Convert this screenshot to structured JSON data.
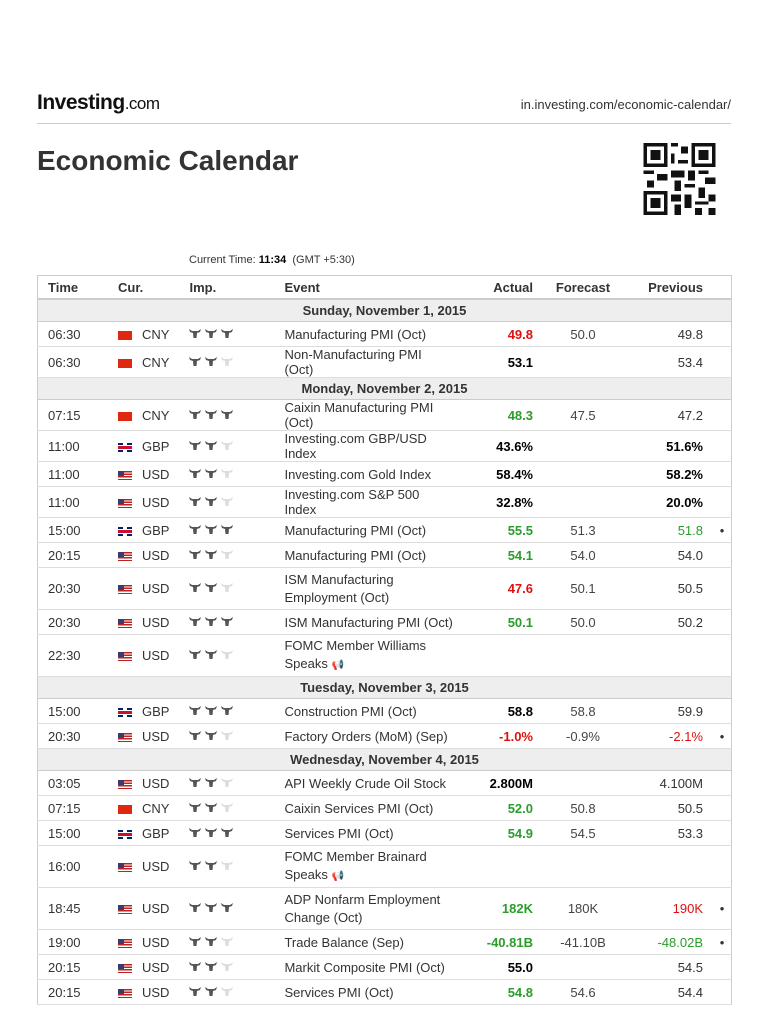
{
  "header": {
    "logo": "Investing",
    "logo_suffix": ".com",
    "url": "in.investing.com/economic-calendar/",
    "title": "Economic Calendar"
  },
  "current_time": {
    "label": "Current Time:",
    "time": "11:34",
    "tz": "(GMT +5:30)"
  },
  "columns": [
    "Time",
    "Cur.",
    "Imp.",
    "Event",
    "Actual",
    "Forecast",
    "Previous"
  ],
  "colors": {
    "positive": "#2a9d2a",
    "negative": "#e01010"
  },
  "rows": [
    {
      "type": "date",
      "label": "Sunday, November 1, 2015"
    },
    {
      "time": "06:30",
      "cur": "CNY",
      "imp": 3,
      "event": "Manufacturing PMI (Oct)",
      "actual": "49.8",
      "as": "neg",
      "forecast": "50.0",
      "previous": "49.8",
      "ps": ""
    },
    {
      "time": "06:30",
      "cur": "CNY",
      "imp": 2,
      "event": "Non-Manufacturing PMI (Oct)",
      "actual": "53.1",
      "as": "neu",
      "forecast": "",
      "previous": "53.4",
      "ps": ""
    },
    {
      "type": "date",
      "label": "Monday, November 2, 2015"
    },
    {
      "time": "07:15",
      "cur": "CNY",
      "imp": 3,
      "event": "Caixin Manufacturing PMI (Oct)",
      "actual": "48.3",
      "as": "pos",
      "forecast": "47.5",
      "previous": "47.2",
      "ps": ""
    },
    {
      "time": "11:00",
      "cur": "GBP",
      "imp": 2,
      "event": "Investing.com GBP/USD Index",
      "actual": "43.6%",
      "as": "neu",
      "forecast": "",
      "previous": "51.6%",
      "ps": "neu"
    },
    {
      "time": "11:00",
      "cur": "USD",
      "imp": 2,
      "event": "Investing.com Gold Index",
      "actual": "58.4%",
      "as": "neu",
      "forecast": "",
      "previous": "58.2%",
      "ps": "neu"
    },
    {
      "time": "11:00",
      "cur": "USD",
      "imp": 2,
      "event": "Investing.com S&P 500 Index",
      "actual": "32.8%",
      "as": "neu",
      "forecast": "",
      "previous": "20.0%",
      "ps": "neu"
    },
    {
      "time": "15:00",
      "cur": "GBP",
      "imp": 3,
      "event": "Manufacturing PMI (Oct)",
      "actual": "55.5",
      "as": "pos",
      "forecast": "51.3",
      "previous": "51.8",
      "ps": "ppos",
      "bullet": "•"
    },
    {
      "time": "20:15",
      "cur": "USD",
      "imp": 2,
      "event": "Manufacturing PMI (Oct)",
      "actual": "54.1",
      "as": "pos",
      "forecast": "54.0",
      "previous": "54.0",
      "ps": ""
    },
    {
      "time": "20:30",
      "cur": "USD",
      "imp": 2,
      "event": "ISM Manufacturing Employment (Oct)",
      "actual": "47.6",
      "as": "neg",
      "forecast": "50.1",
      "previous": "50.5",
      "ps": "",
      "tall": true
    },
    {
      "time": "20:30",
      "cur": "USD",
      "imp": 3,
      "event": "ISM Manufacturing PMI (Oct)",
      "actual": "50.1",
      "as": "pos",
      "forecast": "50.0",
      "previous": "50.2",
      "ps": ""
    },
    {
      "time": "22:30",
      "cur": "USD",
      "imp": 2,
      "event": "FOMC Member Williams Speaks",
      "speech": true,
      "actual": "",
      "as": "",
      "forecast": "",
      "previous": "",
      "ps": "",
      "tall": true
    },
    {
      "type": "date",
      "label": "Tuesday, November 3, 2015"
    },
    {
      "time": "15:00",
      "cur": "GBP",
      "imp": 3,
      "event": "Construction PMI (Oct)",
      "actual": "58.8",
      "as": "neu",
      "forecast": "58.8",
      "previous": "59.9",
      "ps": ""
    },
    {
      "time": "20:30",
      "cur": "USD",
      "imp": 2,
      "event": "Factory Orders (MoM) (Sep)",
      "actual": "-1.0%",
      "as": "neg",
      "forecast": "-0.9%",
      "previous": "-2.1%",
      "ps": "pneg",
      "bullet": "•"
    },
    {
      "type": "date",
      "label": "Wednesday, November 4, 2015"
    },
    {
      "time": "03:05",
      "cur": "USD",
      "imp": 2,
      "event": "API Weekly Crude Oil Stock",
      "actual": "2.800M",
      "as": "neu",
      "forecast": "",
      "previous": "4.100M",
      "ps": ""
    },
    {
      "time": "07:15",
      "cur": "CNY",
      "imp": 2,
      "event": "Caixin Services PMI (Oct)",
      "actual": "52.0",
      "as": "pos",
      "forecast": "50.8",
      "previous": "50.5",
      "ps": ""
    },
    {
      "time": "15:00",
      "cur": "GBP",
      "imp": 3,
      "event": "Services PMI (Oct)",
      "actual": "54.9",
      "as": "pos",
      "forecast": "54.5",
      "previous": "53.3",
      "ps": ""
    },
    {
      "time": "16:00",
      "cur": "USD",
      "imp": 2,
      "event": "FOMC Member Brainard Speaks",
      "speech": true,
      "actual": "",
      "as": "",
      "forecast": "",
      "previous": "",
      "ps": "",
      "tall": true
    },
    {
      "time": "18:45",
      "cur": "USD",
      "imp": 3,
      "event": "ADP Nonfarm Employment Change (Oct)",
      "actual": "182K",
      "as": "pos",
      "forecast": "180K",
      "previous": "190K",
      "ps": "pneg",
      "bullet": "•",
      "tall": true
    },
    {
      "time": "19:00",
      "cur": "USD",
      "imp": 2,
      "event": "Trade Balance (Sep)",
      "actual": "-40.81B",
      "as": "pos",
      "forecast": "-41.10B",
      "previous": "-48.02B",
      "ps": "ppos",
      "bullet": "•"
    },
    {
      "time": "20:15",
      "cur": "USD",
      "imp": 2,
      "event": "Markit Composite PMI (Oct)",
      "actual": "55.0",
      "as": "neu",
      "forecast": "",
      "previous": "54.5",
      "ps": ""
    },
    {
      "time": "20:15",
      "cur": "USD",
      "imp": 2,
      "event": "Services PMI (Oct)",
      "actual": "54.8",
      "as": "pos",
      "forecast": "54.6",
      "previous": "54.4",
      "ps": ""
    }
  ]
}
